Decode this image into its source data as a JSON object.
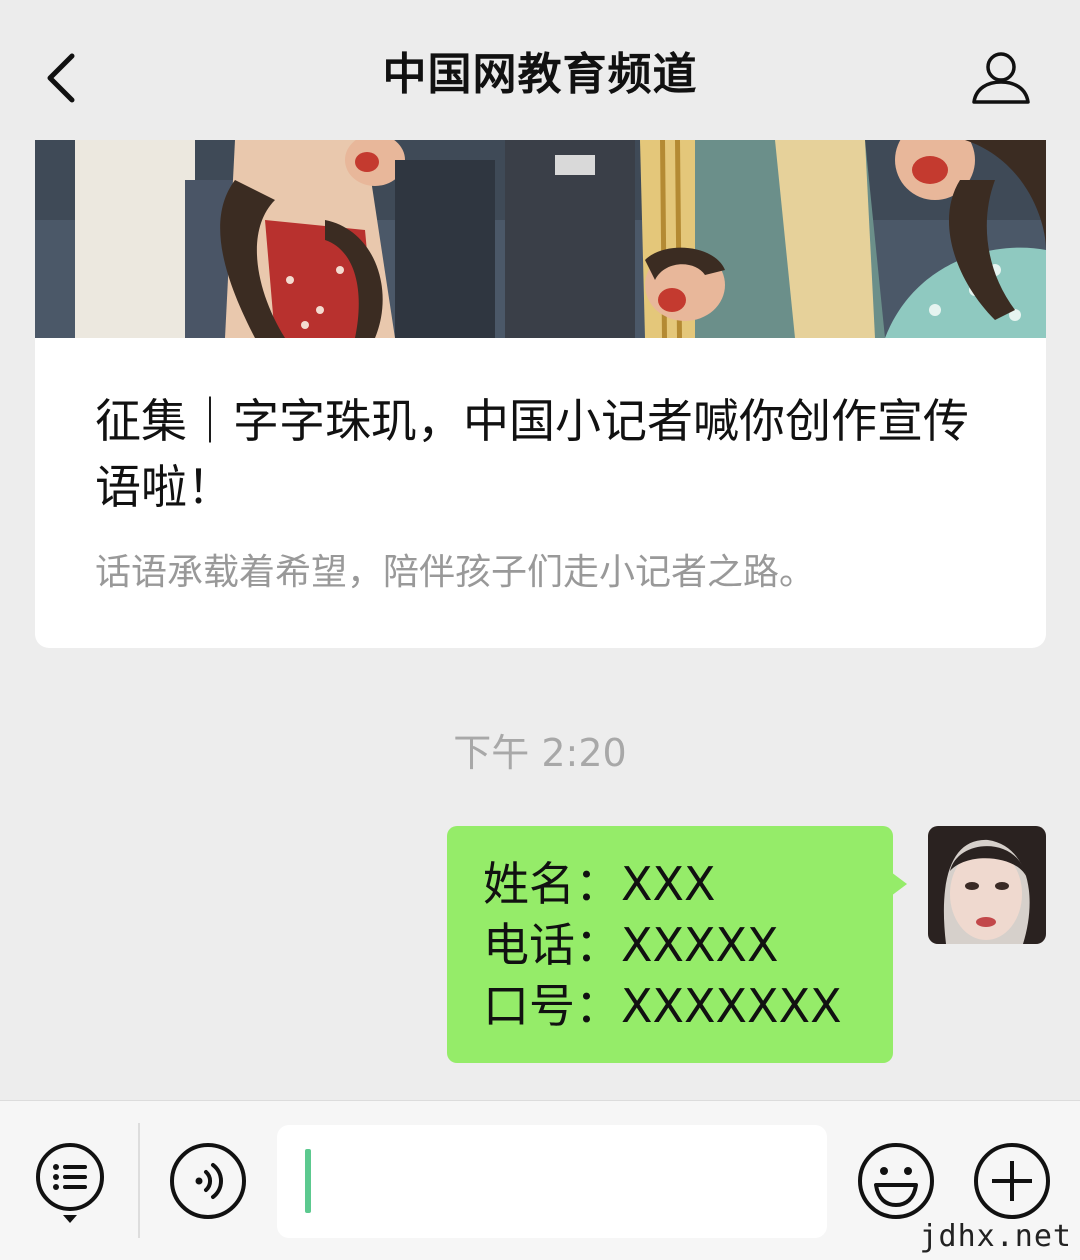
{
  "header": {
    "title": "中国网教育频道"
  },
  "card": {
    "title": "征集｜字字珠玑，中国小记者喊你创作宣传语啦！",
    "description": "话语承载着希望，陪伴孩子们走小记者之路。"
  },
  "time": "下午 2:20",
  "message": {
    "lines": [
      "姓名：XXX",
      "电话：XXXXX",
      "口号：XXXXXXX"
    ]
  },
  "watermark": "jdhx.net",
  "icons": {
    "back": "chevron-left-icon",
    "profile": "person-icon",
    "menu": "menu-list-icon",
    "voice": "voice-icon",
    "emoji": "smiley-icon",
    "plus": "plus-icon"
  },
  "colors": {
    "bubble": "#95ec69",
    "cursor": "#5cc98f",
    "background": "#ededed"
  }
}
